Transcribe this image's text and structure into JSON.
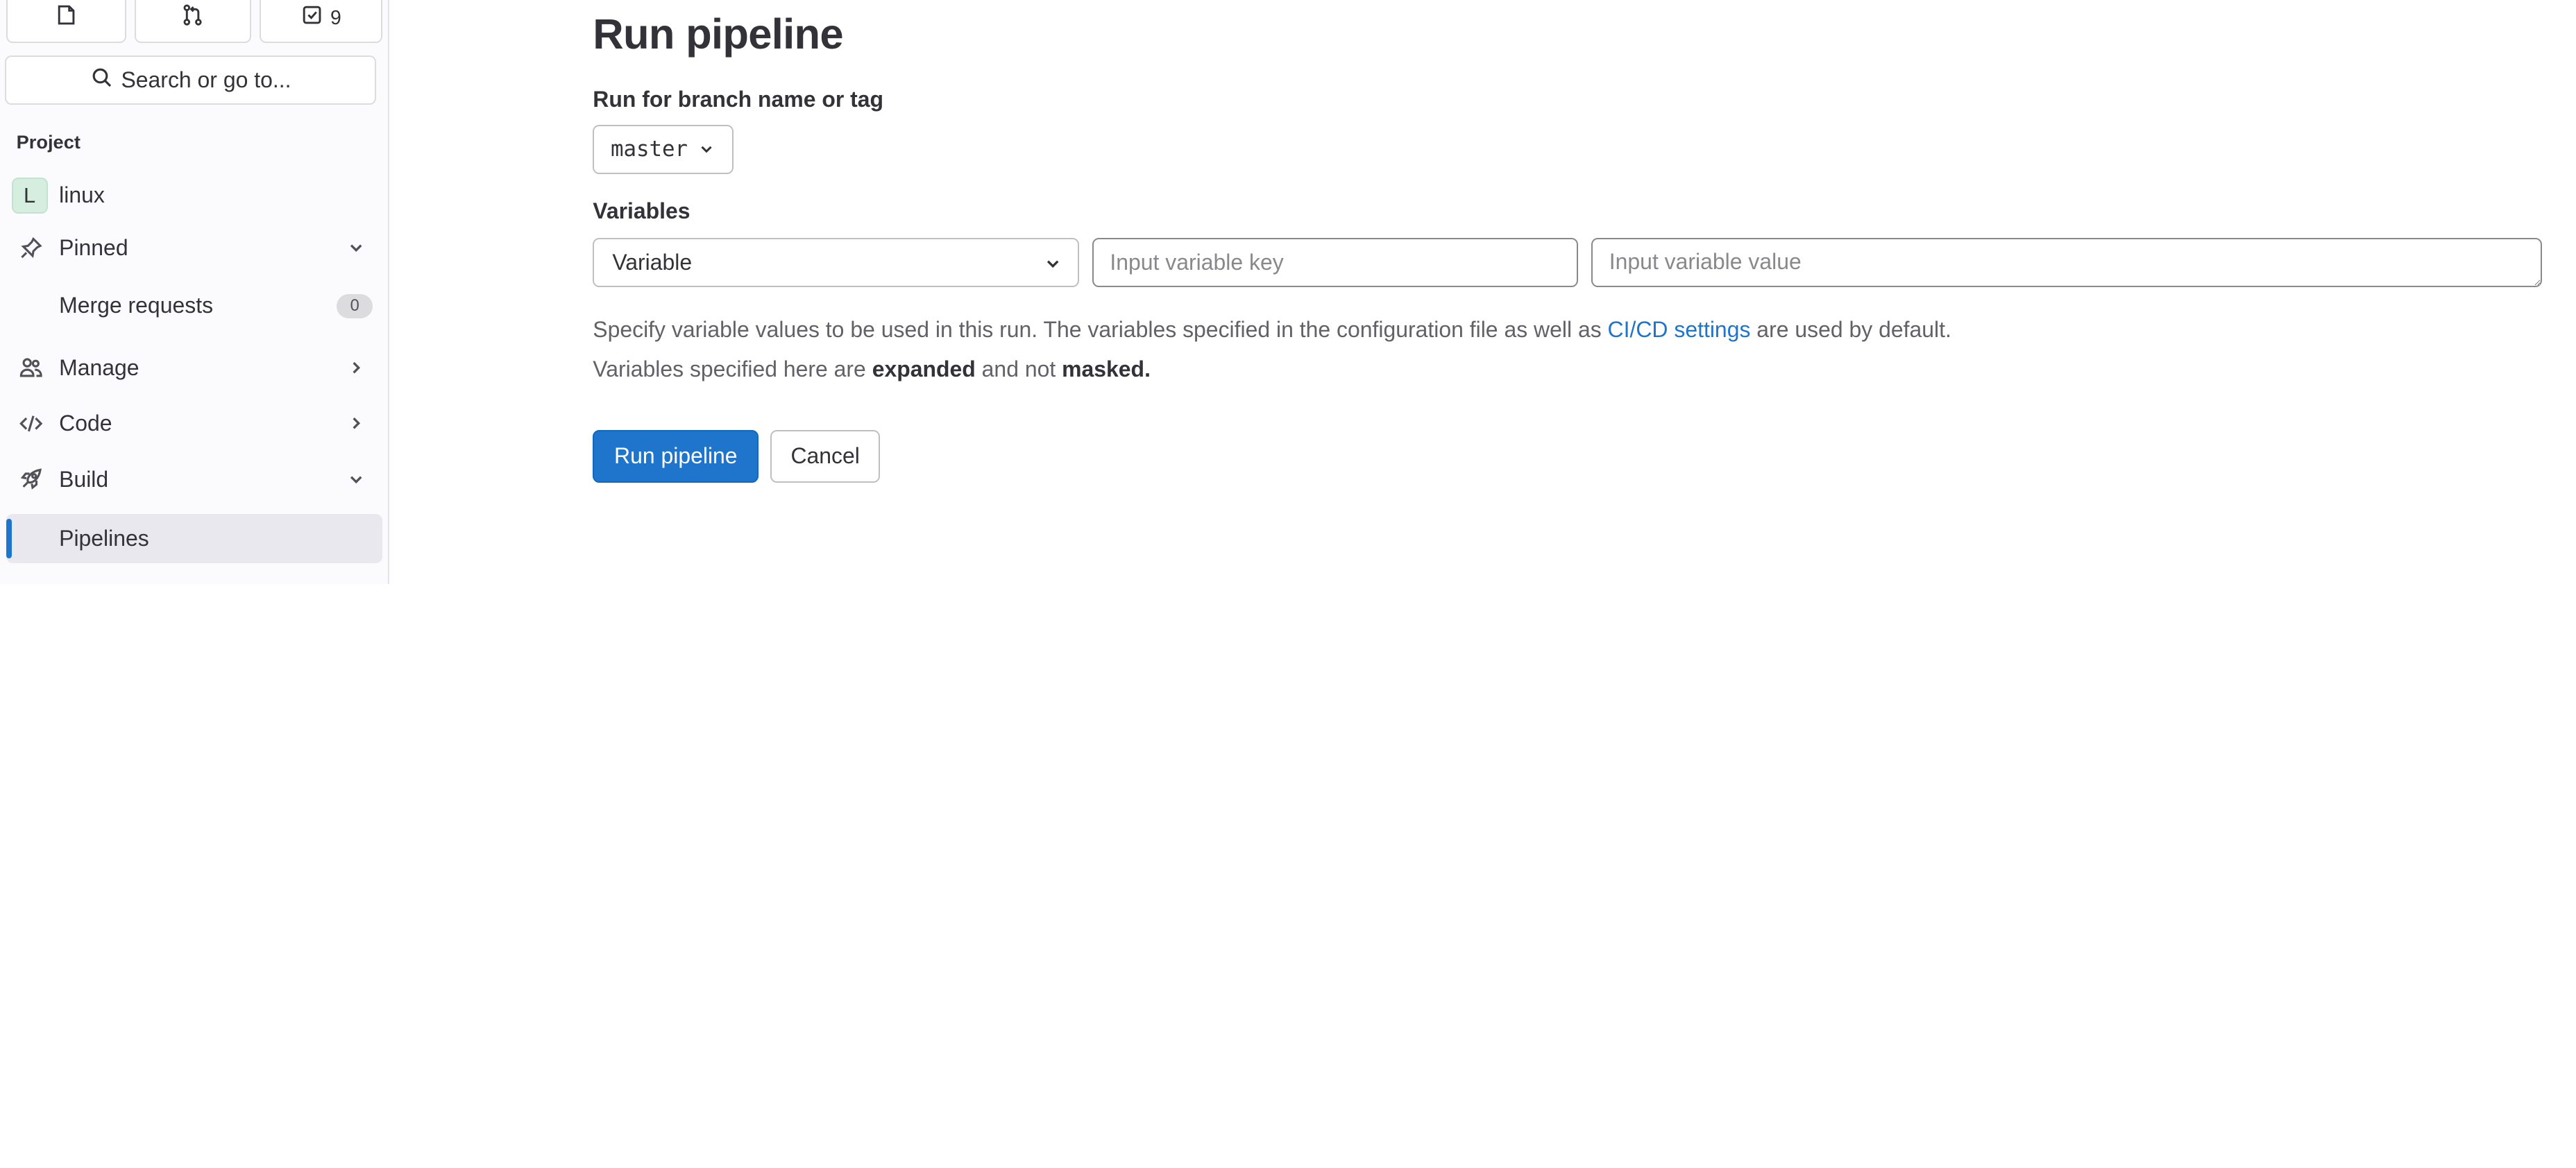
{
  "sidebar": {
    "top_buttons": [
      {
        "icon": "issues-icon",
        "label": ""
      },
      {
        "icon": "merge-request-icon",
        "label": ""
      },
      {
        "icon": "todo-icon",
        "label": "9"
      }
    ],
    "search_label": "Search or go to...",
    "section_label": "Project",
    "project": {
      "avatar_letter": "L",
      "name": "linux"
    },
    "items": {
      "pinned": "Pinned",
      "merge_requests": "Merge requests",
      "merge_requests_count": "0",
      "manage": "Manage",
      "code": "Code",
      "build": "Build",
      "pipelines": "Pipelines"
    }
  },
  "main": {
    "title": "Run pipeline",
    "branch_label": "Run for branch name or tag",
    "branch_value": "master",
    "variables_label": "Variables",
    "variable_type": "Variable",
    "key_placeholder": "Input variable key",
    "value_placeholder": "Input variable value",
    "help_line1_before": "Specify variable values to be used in this run. The variables specified in the configuration file as well as ",
    "help_line1_link": "CI/CD settings",
    "help_line1_after": " are used by default.",
    "help_line2_before": "Variables specified here are ",
    "help_line2_bold1": "expanded",
    "help_line2_mid": " and not ",
    "help_line2_bold2": "masked.",
    "run_button": "Run pipeline",
    "cancel_button": "Cancel"
  },
  "colors": {
    "accent": "#1f75cb",
    "sidebar_bg": "#fbfafd",
    "active_item_bg": "#e9e8ee"
  }
}
